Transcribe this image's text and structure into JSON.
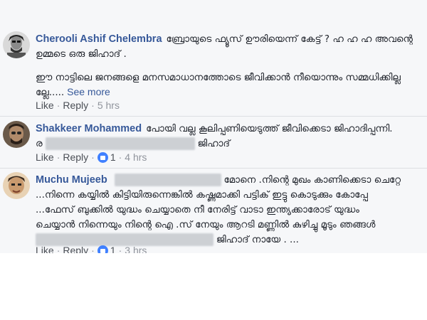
{
  "comments": [
    {
      "name": "Cherooli Ashif Chelembra",
      "line1": "ബ്രോയുടെ ഫ്യൂസ് ഊരിയെന്ന് കേട്ട് ? ഹ ഹ ഹ അവന്റെ",
      "line2": "ഉമ്മടെ ഒരു ജിഹാദ് .",
      "line3": "ഈ നാട്ടിലെ ജനങ്ങളെ മനസമാധാനത്തോടെ ജീവിക്കാൻ നീയൊന്നും സമ്മധിക്കില്ല",
      "line4": "ല്ലേ.....",
      "see_more": "See more",
      "like": "Like",
      "reply": "Reply",
      "time": "5 hrs"
    },
    {
      "name": "Shakkeer Mohammed",
      "line1": "പോയി വല്ല കൂലിപ്പണിയെടുത്ത് ജീവിക്കെടാ ജിഹാദിപ്പന്നി.",
      "line2_prefix": "ര",
      "line2_suffix": "ജിഹാദ്",
      "like": "Like",
      "reply": "Reply",
      "reaction_count": "1",
      "time": "4 hrs"
    },
    {
      "name": "Muchu Mujeeb",
      "line1": "മോനെ .നിന്റെ മുഖം കാണിക്കെടാ ചെറ്റേ",
      "line2": "...നിന്നെ കയ്യിൽ കിട്ടിയിരുന്നെങ്കിൽ കഷ്ണമാക്കി പട്ടിക് ഇട്ടു കൊടുക്കും കോപ്പേ",
      "line3": "...ഫേസ് ബുക്കിൽ യുദ്ധം ചെയ്യാതെ നീ നേരിട്ട് വാടാ ഇന്ത്യക്കാരോട് യുദ്ധം",
      "line4": "ചെയ്യാൻ നിന്നെയും നിന്റെ ഐ .സ് നേയും ആറടി മണ്ണിൽ കുഴിച്ചു മൂടും ഞങ്ങൾ",
      "line5": "ജിഹാദ് നായേ . ...",
      "like": "Like",
      "reply": "Reply",
      "reaction_count": "1",
      "time": "3 hrs"
    }
  ],
  "icons": {
    "like_reaction": "like-reaction-icon"
  },
  "colors": {
    "name": "#365899",
    "meta": "#90949c",
    "panel": "#f6f7f9",
    "like_blue": "#4080ff"
  }
}
